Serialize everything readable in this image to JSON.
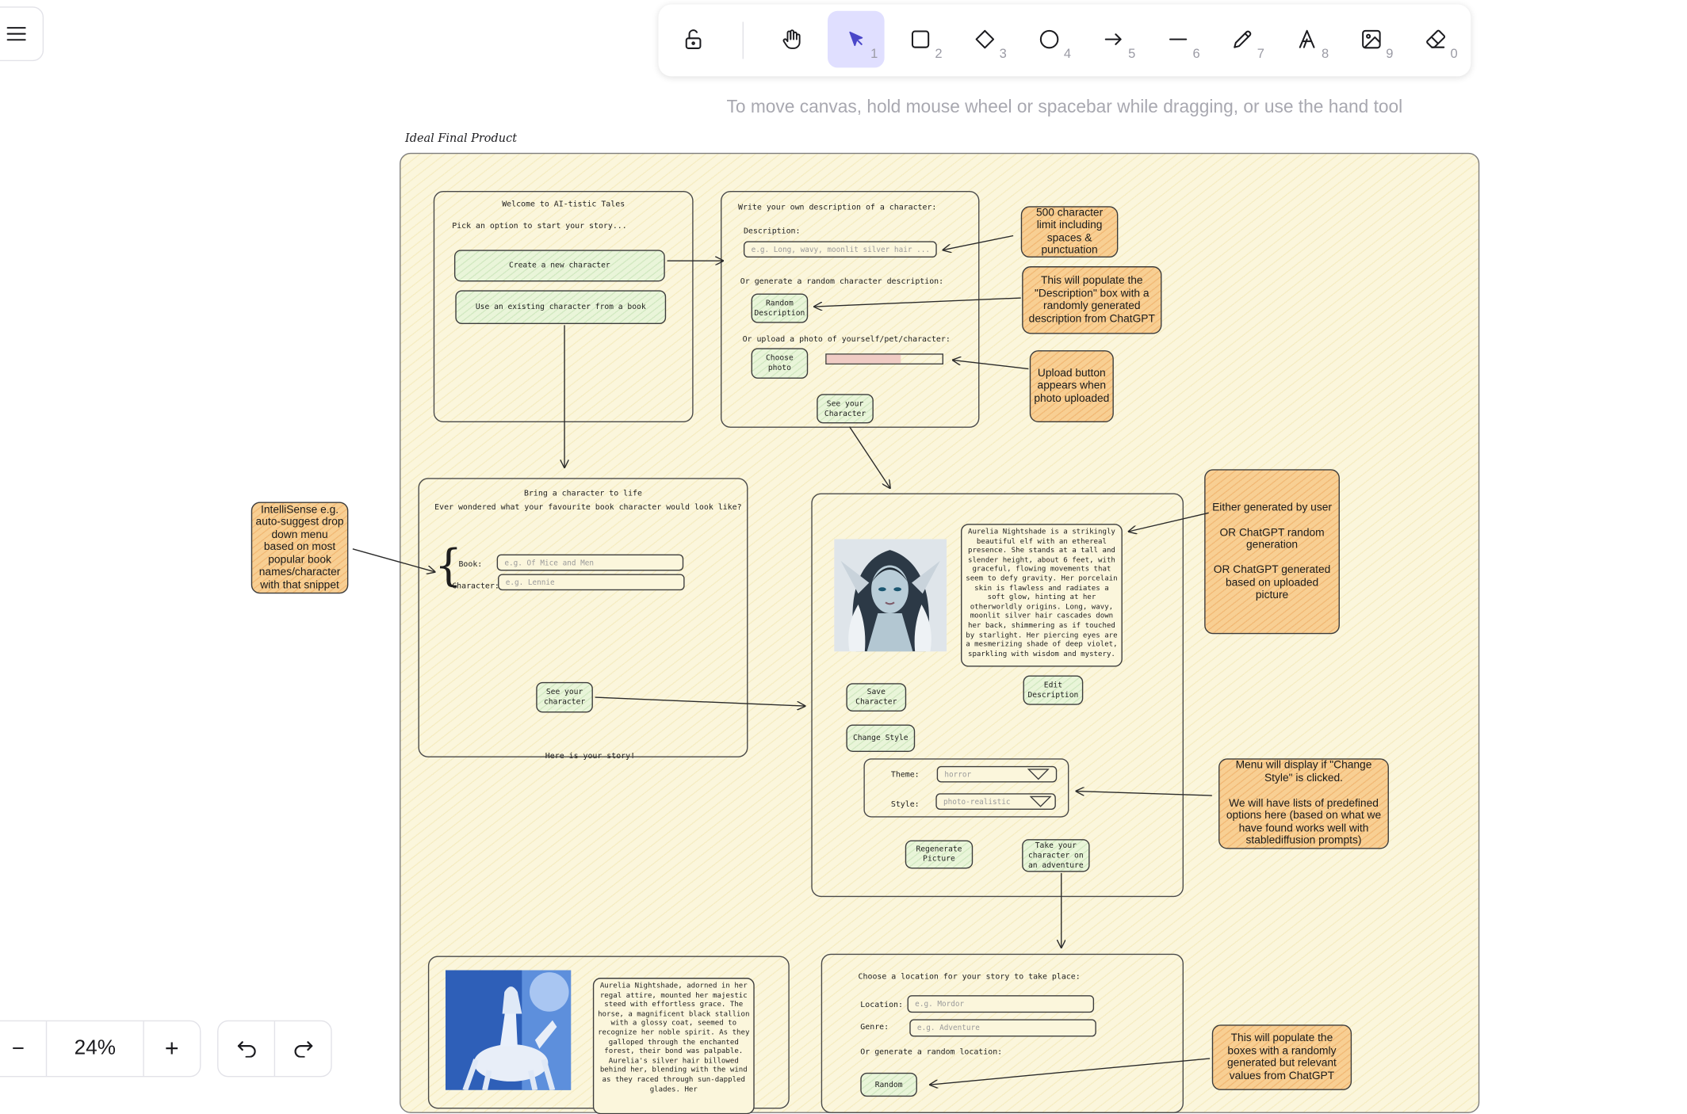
{
  "toolbar": {
    "tools": [
      {
        "name": "lock",
        "shortcut": ""
      },
      {
        "name": "hand",
        "shortcut": ""
      },
      {
        "name": "selection",
        "shortcut": "1"
      },
      {
        "name": "rectangle",
        "shortcut": "2"
      },
      {
        "name": "diamond",
        "shortcut": "3"
      },
      {
        "name": "ellipse",
        "shortcut": "4"
      },
      {
        "name": "arrow",
        "shortcut": "5"
      },
      {
        "name": "line",
        "shortcut": "6"
      },
      {
        "name": "draw",
        "shortcut": "7"
      },
      {
        "name": "text",
        "shortcut": "8"
      },
      {
        "name": "image",
        "shortcut": "9"
      },
      {
        "name": "eraser",
        "shortcut": "0"
      }
    ],
    "active_tool": "selection"
  },
  "hint": "To move canvas, hold mouse wheel or spacebar while dragging, or use the hand tool",
  "frame_label": "Ideal Final Product",
  "screen1": {
    "title": "Welcome to AI-tistic Tales",
    "subtitle": "Pick an option to start your story...",
    "btn_new": "Create a new character",
    "btn_existing": "Use an existing character from a book"
  },
  "screen2": {
    "title": "Write your own description of a character:",
    "desc_label": "Description:",
    "desc_placeholder": "e.g. Long, wavy, moonlit silver hair ...",
    "random_label": "Or generate a random character description:",
    "random_btn": "Random Description",
    "upload_label": "Or upload a photo of yourself/pet/character:",
    "choose_btn": "Choose photo",
    "see_btn": "See your Character"
  },
  "screen3": {
    "title": "Bring a character to life",
    "subtitle": "Ever wondered what your favourite book character would look like?",
    "book_label": "Book:",
    "book_placeholder": "e.g. Of Mice and Men",
    "char_label": "Character:",
    "char_placeholder": "e.g. Lennie",
    "see_btn": "See your character",
    "footer": "Here is your story!"
  },
  "screen4": {
    "description": "Aurelia Nightshade is a strikingly beautiful elf with an ethereal presence. She stands at a tall and slender height, about 6 feet, with graceful, flowing movements that seem to defy gravity. Her porcelain skin is flawless and radiates a soft glow, hinting at her otherworldly origins. Long, wavy, moonlit silver hair cascades down her back, shimmering as if touched by starlight. Her piercing eyes are a mesmerizing shade of deep violet, sparkling with wisdom and mystery.",
    "save_btn": "Save Character",
    "edit_btn": "Edit Description",
    "change_style_btn": "Change Style",
    "theme_label": "Theme:",
    "theme_value": "horror",
    "style_label": "Style:",
    "style_value": "photo-realistic",
    "regen_btn": "Regenerate Picture",
    "adventure_btn": "Take your character on an adventure"
  },
  "screen5": {
    "story": "Aurelia Nightshade, adorned in her regal attire, mounted her majestic steed with effortless grace. The horse, a magnificent black stallion with a glossy coat, seemed to recognize her noble spirit. As they galloped through the enchanted forest, their bond was palpable. Aurelia's silver hair billowed behind her, blending with the wind as they raced through sun-dappled glades. Her"
  },
  "screen6": {
    "title": "Choose a location for your story to take place:",
    "location_label": "Location:",
    "location_placeholder": "e.g. Mordor",
    "genre_label": "Genre:",
    "genre_placeholder": "e.g. Adventure",
    "random_label": "Or generate a random location:",
    "random_btn": "Random"
  },
  "notes": {
    "char_limit": "500 character limit including spaces & punctuation",
    "populate_desc": "This will populate the \"Description\" box with a randomly generated description from ChatGPT",
    "upload_btn": "Upload button appears when photo uploaded",
    "intellisense": "IntelliSense e.g. auto-suggest drop down menu based on most popular book names/character with that snippet",
    "generated": "Either generated by user\n\nOR ChatGPT random generation\n\nOR ChatGPT generated based on uploaded picture",
    "menu_display": "Menu will display if \"Change Style\" is clicked.\n\nWe will have lists of predefined options here (based on what we have found works well with stablediffusion prompts)",
    "populate_boxes": "This will populate the boxes with a randomly generated but relevant values from ChatGPT"
  },
  "zoom": {
    "minus": "−",
    "level": "24%",
    "plus": "+"
  },
  "history": {
    "undo": "undo",
    "redo": "redo"
  },
  "colors": {
    "accent": "#6965db",
    "accent_bg": "#e0dfff",
    "frame_bg": "#fbf6dc",
    "note_bg": "#f8cf93",
    "button_bg": "#e9f5d9"
  }
}
